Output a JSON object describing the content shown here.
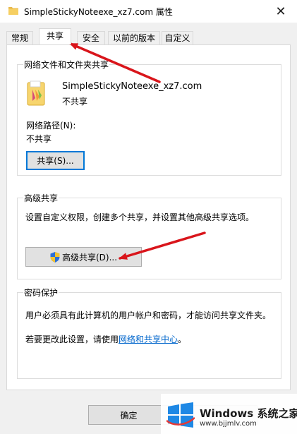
{
  "window": {
    "title": "SimpleStickyNoteexe_xz7.com 属性",
    "close_icon": "close-icon"
  },
  "tabs": [
    {
      "label": "常规",
      "active": false
    },
    {
      "label": "共享",
      "active": true
    },
    {
      "label": "安全",
      "active": false
    },
    {
      "label": "以前的版本",
      "active": false
    },
    {
      "label": "自定义",
      "active": false
    }
  ],
  "network_sharing": {
    "group_label": "网络文件和文件夹共享",
    "item_name": "SimpleStickyNoteexe_xz7.com",
    "item_status": "不共享",
    "path_label": "网络路径(N):",
    "path_value": "不共享",
    "share_button": "共享(S)..."
  },
  "advanced_sharing": {
    "group_label": "高级共享",
    "description": "设置自定义权限，创建多个共享，并设置其他高级共享选项。",
    "button": "高级共享(D)...",
    "button_icon": "uac-shield-icon"
  },
  "password_protection": {
    "group_label": "密码保护",
    "description": "用户必须具有此计算机的用户帐户和密码，才能访问共享文件夹。",
    "change_prefix": "若要更改此设置，请使用",
    "change_link": "网络和共享中心",
    "change_suffix": "。"
  },
  "footer": {
    "ok_button": "确定"
  },
  "watermark": {
    "brand_en": "Windows",
    "brand_cn": "系统之家",
    "site": "www.bjjmlv.com"
  },
  "colors": {
    "accent": "#0078d7",
    "link": "#0066cc",
    "annotation_arrow": "#d9151b"
  }
}
